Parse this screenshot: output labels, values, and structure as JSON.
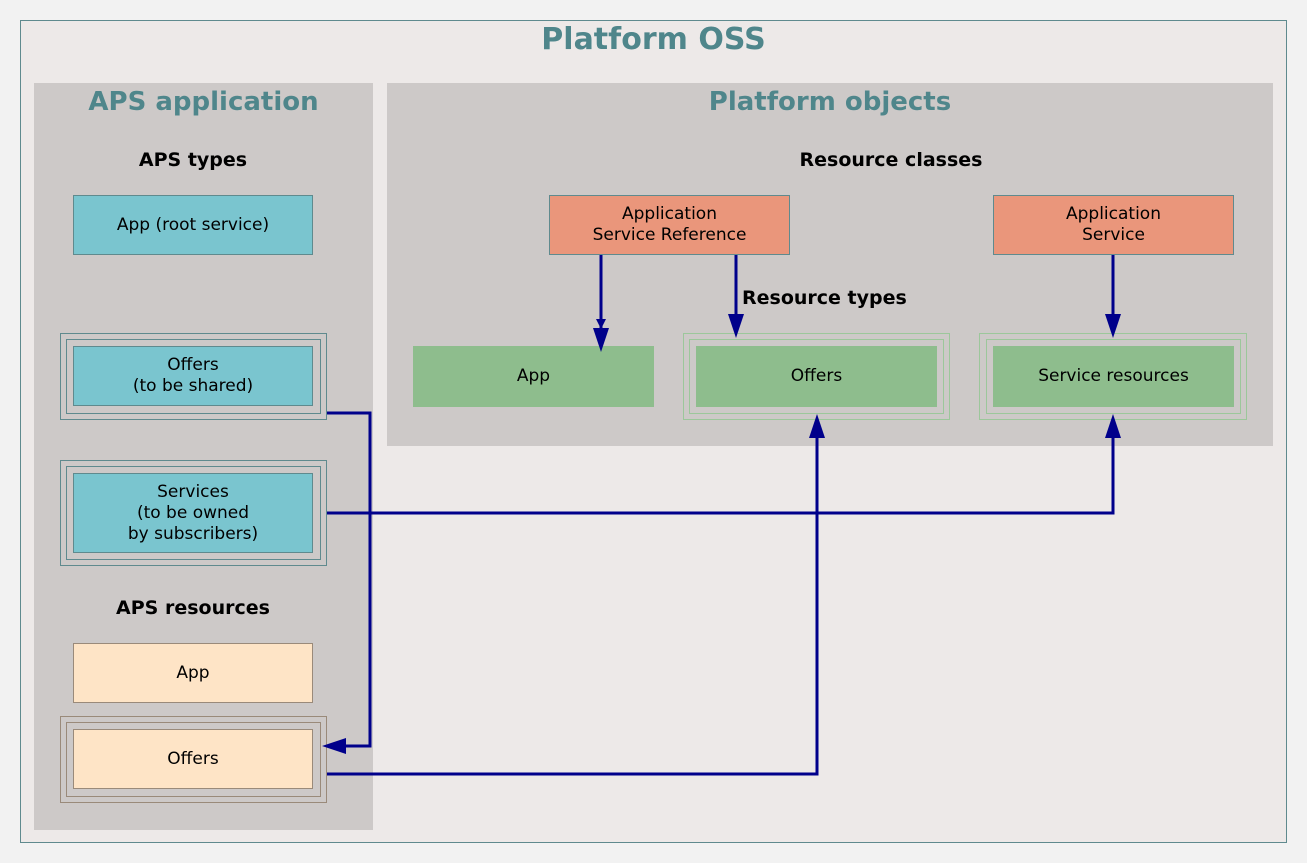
{
  "diagram": {
    "title": "Platform OSS",
    "clusters": {
      "aps_application": {
        "title": "APS application",
        "sections": {
          "types": "APS types",
          "resources": "APS resources"
        },
        "nodes": {
          "app_root": "App (root service)",
          "offers_shared": "Offers\n(to be shared)",
          "services_owned": "Services\n(to be owned\nby subscribers)",
          "res_app": "App",
          "res_offers": "Offers"
        }
      },
      "platform_objects": {
        "title": "Platform objects",
        "sections": {
          "classes": "Resource classes",
          "types": "Resource types"
        },
        "nodes": {
          "asr": "Application\nService Reference",
          "as": "Application\nService",
          "rt_app": "App",
          "rt_offers": "Offers",
          "rt_service_resources": "Service resources"
        }
      }
    },
    "edges": [
      {
        "from": "Application Service Reference",
        "to": "App (resource type)"
      },
      {
        "from": "Application Service Reference",
        "to": "Offers (resource type)"
      },
      {
        "from": "Application Service",
        "to": "Service resources"
      },
      {
        "from": "Offers (to be shared)",
        "to": "Offers (APS resource)"
      },
      {
        "from": "Services (to be owned by subscribers)",
        "to": "Service resources"
      },
      {
        "from": "Offers (APS resource)",
        "to": "Offers (resource type)"
      }
    ],
    "colors": {
      "edge": "#00008b",
      "title": "#4f868b",
      "aps_type": "#7ac5cf",
      "resource_class": "#ea967b",
      "resource_type": "#8ebd8d",
      "aps_resource": "#fee4c6"
    }
  }
}
